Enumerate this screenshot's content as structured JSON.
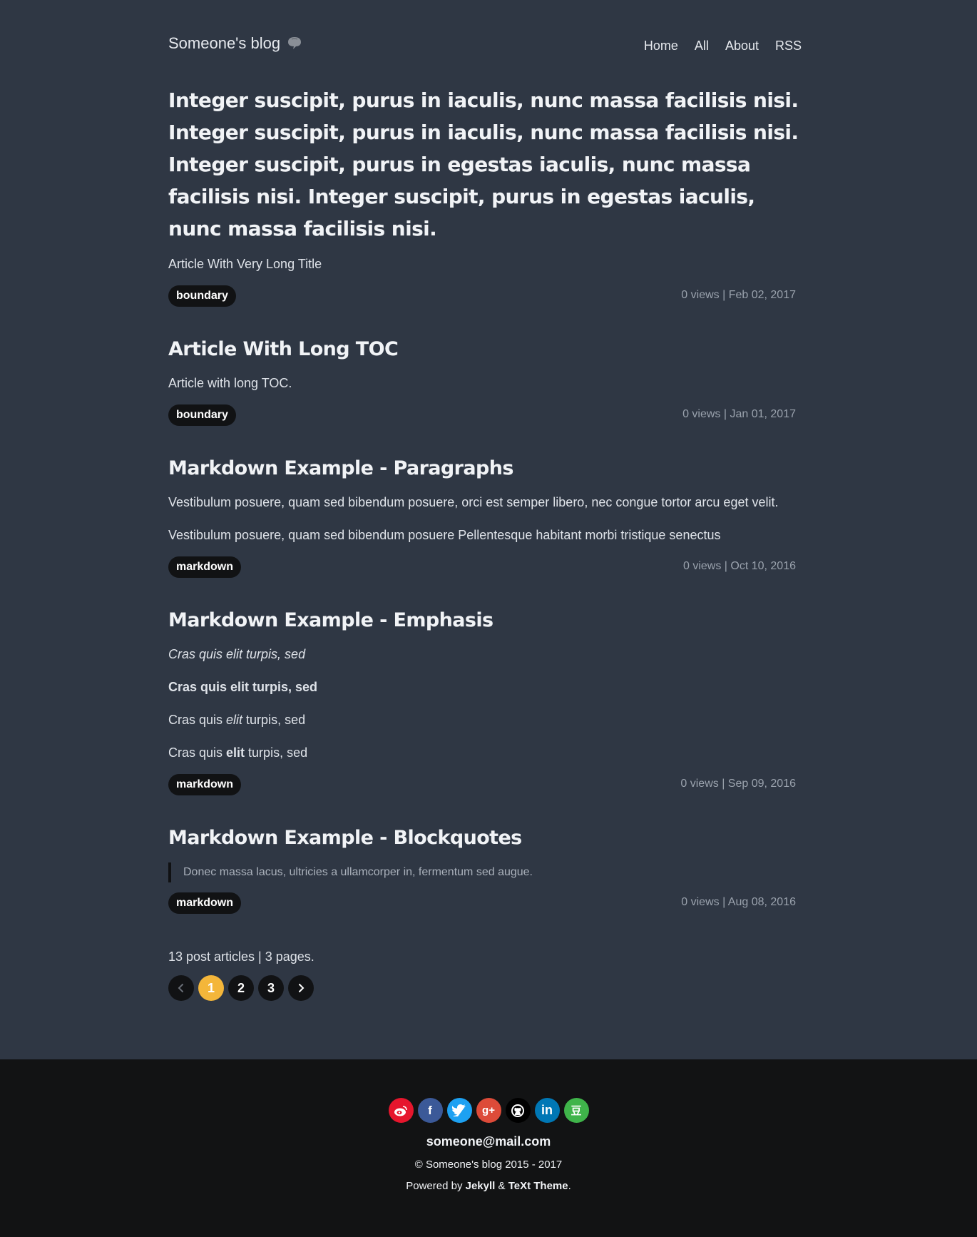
{
  "header": {
    "brand": "Someone's blog",
    "nav": [
      "Home",
      "All",
      "About",
      "RSS"
    ]
  },
  "posts": [
    {
      "title": "Integer suscipit, purus in iaculis, nunc massa facilisis nisi. Integer suscipit, purus in iaculis, nunc massa facilisis nisi. Integer suscipit, purus in egestas iaculis, nunc massa facilisis nisi. Integer suscipit, purus in egestas iaculis, nunc massa facilisis nisi.",
      "excerpt": [
        "Article With Very Long Title"
      ],
      "tag": "boundary",
      "meta": "0 views | Feb 02, 2017"
    },
    {
      "title": "Article With Long TOC",
      "excerpt": [
        "Article with long TOC."
      ],
      "tag": "boundary",
      "meta": "0 views | Jan 01, 2017"
    },
    {
      "title": "Markdown Example - Paragraphs",
      "excerpt": [
        "Vestibulum posuere, quam sed bibendum posuere, orci est semper libero, nec congue tortor arcu eget velit.",
        "Vestibulum posuere, quam sed bibendum posuere Pellentesque habitant morbi tristique senectus"
      ],
      "tag": "markdown",
      "meta": "0 views | Oct 10, 2016"
    },
    {
      "title": "Markdown Example - Emphasis",
      "emphasis": {
        "p1": "Cras quis elit turpis, sed",
        "p2": "Cras quis elit turpis, sed",
        "p3_a": "Cras quis ",
        "p3_b": "elit",
        "p3_c": " turpis, sed",
        "p4_a": "Cras quis ",
        "p4_b": "elit",
        "p4_c": " turpis, sed"
      },
      "tag": "markdown",
      "meta": "0 views | Sep 09, 2016"
    },
    {
      "title": "Markdown Example - Blockquotes",
      "quote": "Donec massa lacus, ultricies a ullamcorper in, fermentum sed augue.",
      "tag": "markdown",
      "meta": "0 views | Aug 08, 2016"
    }
  ],
  "pagination": {
    "info": "13 post articles | 3 pages.",
    "prev_icon": "chevron-left-icon",
    "next_icon": "chevron-right-icon",
    "pages": [
      "1",
      "2",
      "3"
    ],
    "current": "1"
  },
  "footer": {
    "socials": [
      {
        "name": "weibo-icon",
        "color": "#e6162d"
      },
      {
        "name": "facebook-icon",
        "color": "#3b5998",
        "glyph": "f"
      },
      {
        "name": "twitter-icon",
        "color": "#1da1f2"
      },
      {
        "name": "google-plus-icon",
        "color": "#dd4b39",
        "glyph": "g+"
      },
      {
        "name": "github-icon",
        "color": "#000000"
      },
      {
        "name": "linkedin-icon",
        "color": "#0077b5",
        "glyph": "in"
      },
      {
        "name": "douban-icon",
        "color": "#3fb44a",
        "glyph": "豆"
      }
    ],
    "email": "someone@mail.com",
    "copyright": "© Someone's blog 2015 - 2017",
    "powered_prefix": "Powered by ",
    "powered_jekyll": "Jekyll",
    "powered_amp": " & ",
    "powered_theme": "TeXt Theme",
    "powered_suffix": "."
  },
  "colors": {
    "background": "#2f3744",
    "footer_background": "#121314",
    "tag_background": "#111214",
    "active_page": "#f4b63a"
  }
}
